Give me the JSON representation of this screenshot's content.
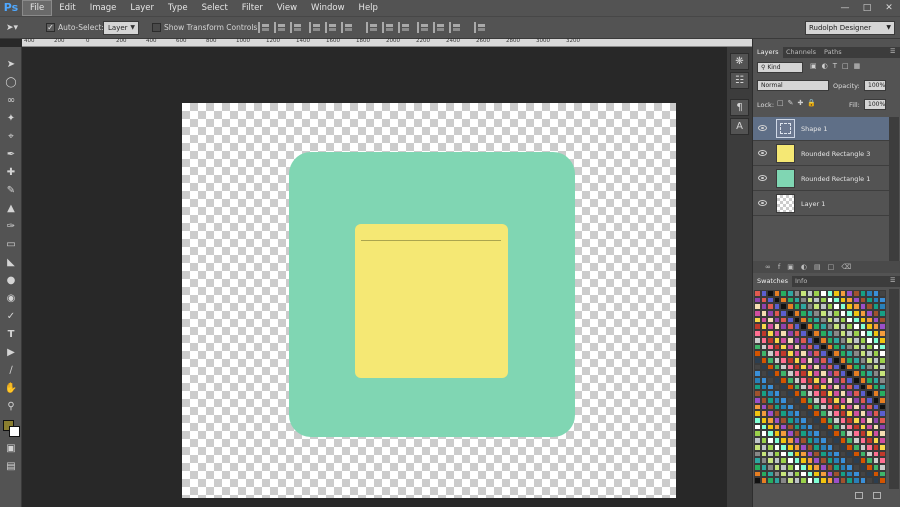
{
  "app": {
    "logo": "Ps"
  },
  "menu": [
    "File",
    "Edit",
    "Image",
    "Layer",
    "Type",
    "Select",
    "Filter",
    "View",
    "Window",
    "Help"
  ],
  "options": {
    "auto_select_label": "Auto-Select:",
    "auto_select_checked": true,
    "target_value": "Layer",
    "show_transform_label": "Show Transform Controls",
    "show_transform_checked": false,
    "workspace": "Rudolph Designer"
  },
  "ruler": {
    "ticks": [
      "400",
      "200",
      "0",
      "200",
      "400",
      "600",
      "800",
      "1000",
      "1200",
      "1400",
      "1600",
      "1800",
      "2000",
      "2200",
      "2400",
      "2600",
      "2800",
      "3000",
      "3200"
    ]
  },
  "canvas": {
    "colors": {
      "green": "#80d6b3",
      "yellow": "#f5e874",
      "line": "#a39d4a"
    }
  },
  "layers_panel": {
    "tabs": [
      "Layers",
      "Channels",
      "Paths"
    ],
    "filter_kind": "Kind",
    "blend_mode": "Normal",
    "opacity_label": "Opacity:",
    "opacity_value": "100%",
    "lock_label": "Lock:",
    "fill_label": "Fill:",
    "fill_value": "100%",
    "layers": [
      {
        "name": "Shape 1",
        "selected": true,
        "thumb": "shape"
      },
      {
        "name": "Rounded Rectangle 3",
        "selected": false,
        "thumb": "#f5e874"
      },
      {
        "name": "Rounded Rectangle 1",
        "selected": false,
        "thumb": "#80d6b3"
      },
      {
        "name": "Layer 1",
        "selected": false,
        "thumb": "transparent"
      }
    ]
  },
  "swatches_panel": {
    "tabs": [
      "Swatches",
      "Info"
    ]
  },
  "foreground_color": "#8a7e2f",
  "background_color": "#ffffff"
}
